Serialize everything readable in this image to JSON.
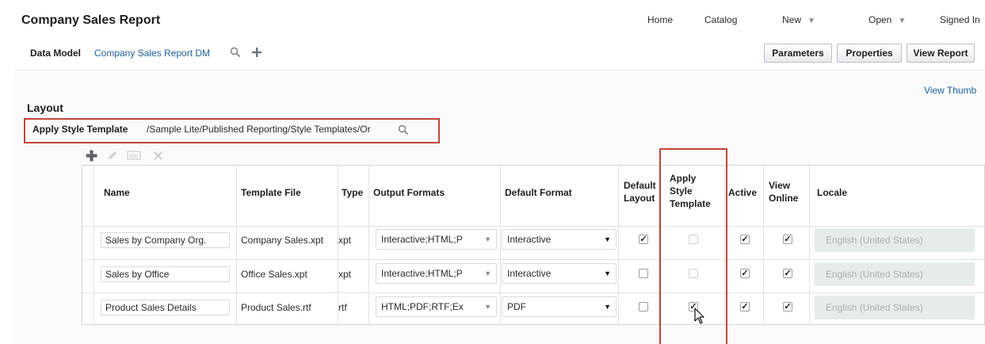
{
  "app": {
    "title": "Company Sales Report"
  },
  "top_nav": {
    "home": "Home",
    "catalog": "Catalog",
    "new": "New",
    "open": "Open",
    "signed_in": "Signed In"
  },
  "subbar": {
    "data_model_label": "Data Model",
    "data_model_link": "Company Sales Report DM",
    "parameters": "Parameters",
    "properties": "Properties",
    "view_report": "View Report"
  },
  "main": {
    "view_thumbnails": "View Thumb",
    "layout_heading": "Layout",
    "apply_style_template_label": "Apply Style Template",
    "apply_style_template_path": "/Sample Lite/Published Reporting/Style Templates/Or"
  },
  "toolbar_icons": [
    "add-icon",
    "edit-icon",
    "xpt-icon",
    "delete-icon"
  ],
  "table": {
    "headers": {
      "name": "Name",
      "template_file": "Template File",
      "type": "Type",
      "output_formats": "Output Formats",
      "default_format": "Default Format",
      "default_layout": [
        "Default",
        "Layout"
      ],
      "apply_style_template": [
        "Apply",
        "Style",
        "Template"
      ],
      "active": "Active",
      "view_online": [
        "View",
        "Online"
      ],
      "locale": "Locale"
    },
    "rows": [
      {
        "name": "Sales by Company Org.",
        "template_file": "Company Sales.xpt",
        "type": "xpt",
        "output_formats": "Interactive;HTML;P",
        "default_format": "Interactive",
        "default_layout": true,
        "apply_style": false,
        "active": true,
        "view_online": true,
        "locale": "English (United States)"
      },
      {
        "name": "Sales by Office",
        "template_file": "Office Sales.xpt",
        "type": "xpt",
        "output_formats": "Interactive;HTML;P",
        "default_format": "Interactive",
        "default_layout": false,
        "apply_style": false,
        "active": true,
        "view_online": true,
        "locale": "English (United States)"
      },
      {
        "name": "Product Sales Details",
        "template_file": "Product Sales.rtf",
        "type": "rtf",
        "output_formats": "HTML;PDF;RTF;Ex",
        "default_format": "PDF",
        "default_layout": false,
        "apply_style": true,
        "active": true,
        "view_online": true,
        "locale": "English (United States)"
      }
    ]
  },
  "colors": {
    "link": "#1f5fa0",
    "highlight_box": "#c0463a",
    "locale_bg": "#e6eceb"
  }
}
